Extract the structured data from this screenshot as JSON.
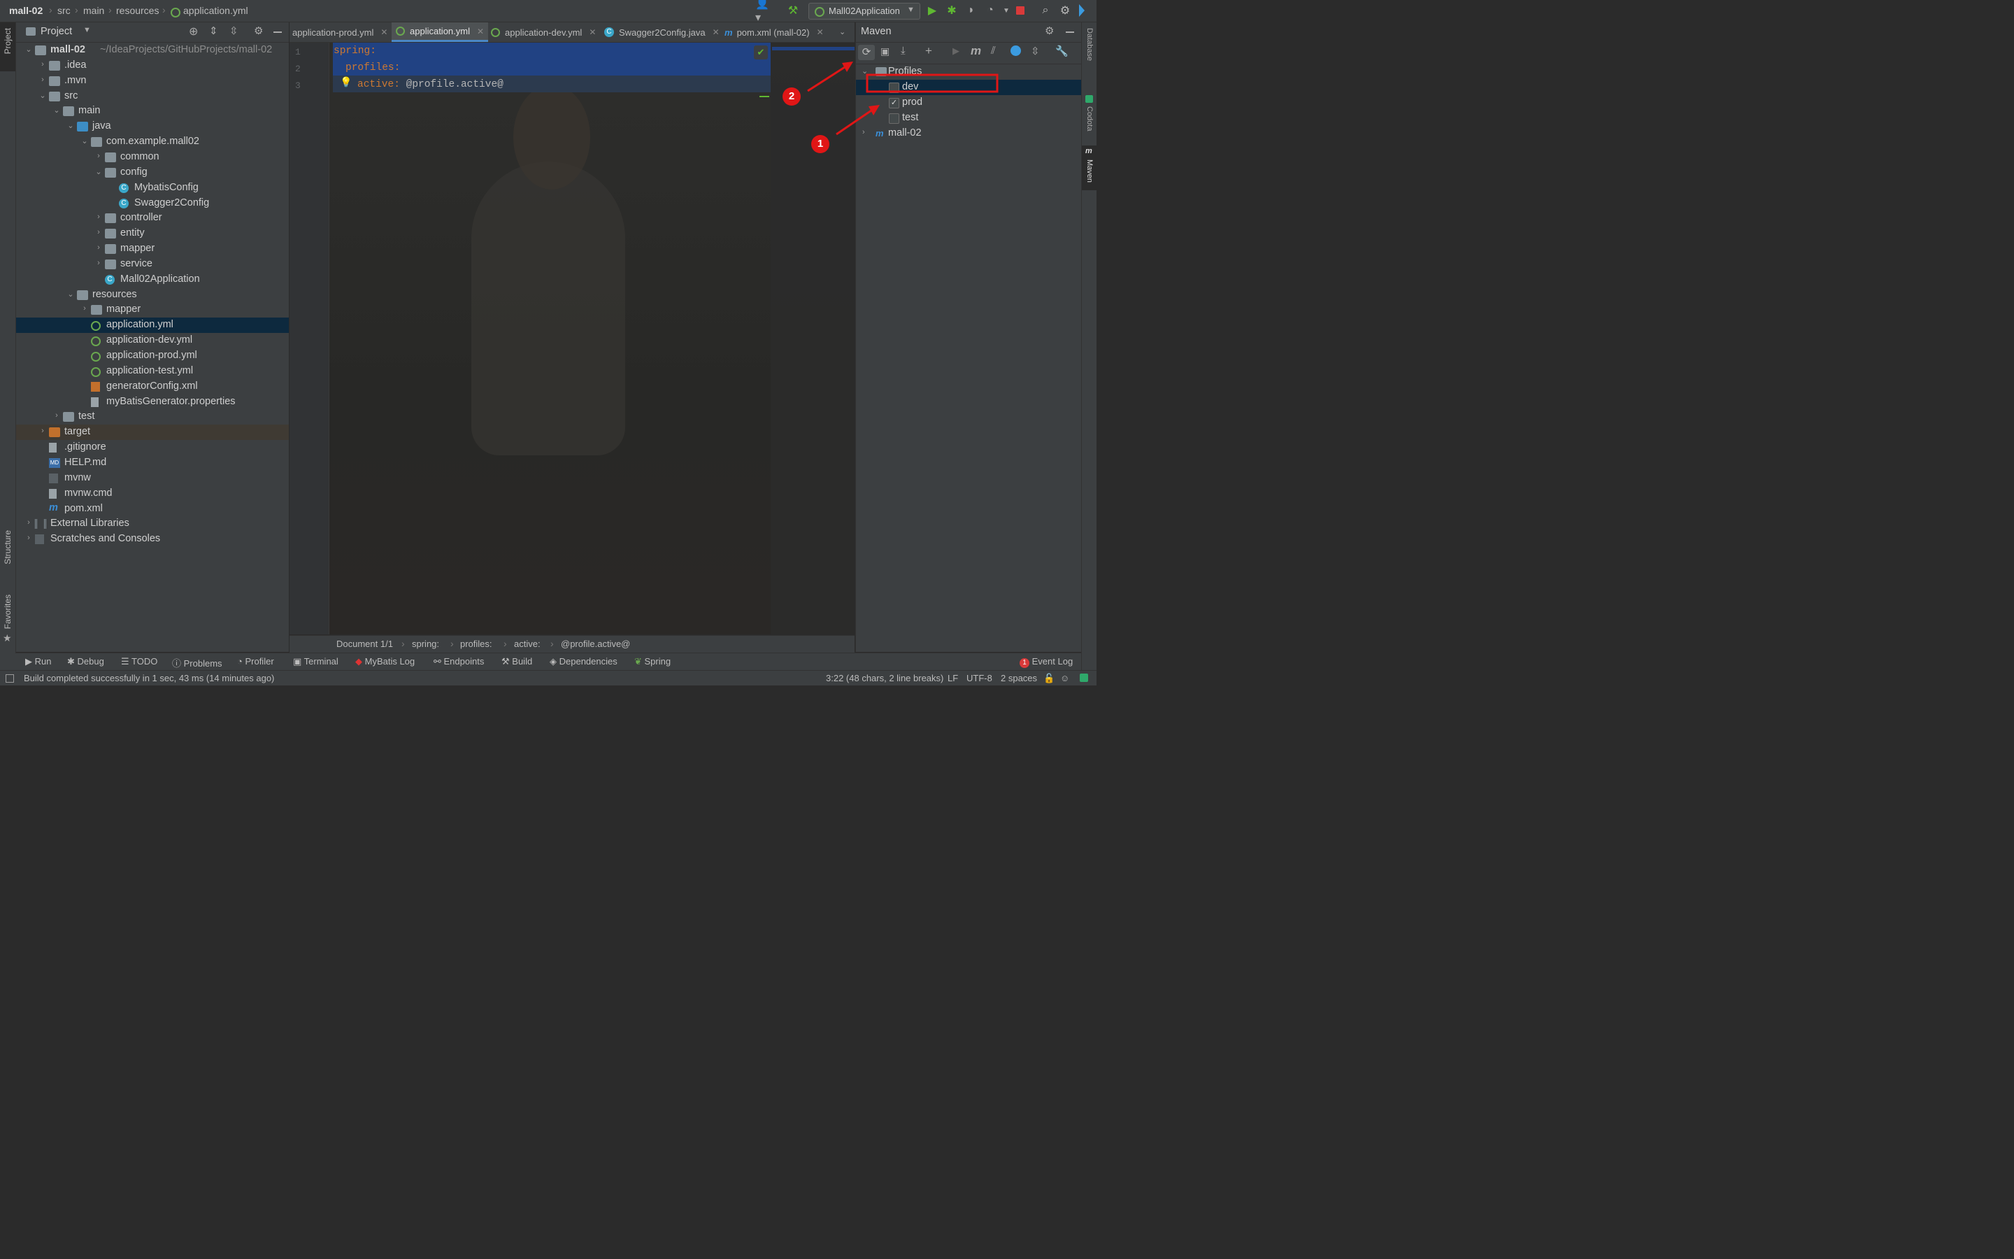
{
  "navbar": {
    "breadcrumbs": [
      "mall-02",
      "src",
      "main",
      "resources",
      "application.yml"
    ],
    "run_config": "Mall02Application"
  },
  "left_stripe": {
    "project": "Project",
    "structure": "Structure",
    "favorites": "Favorites"
  },
  "project_panel": {
    "title": "Project",
    "tree": [
      {
        "label": "mall-02",
        "hint": "~/IdeaProjects/GitHubProjects/mall-02",
        "depth": 0,
        "arrow": "open",
        "icon": "module-folder-icon"
      },
      {
        "label": ".idea",
        "depth": 1,
        "arrow": "closed",
        "icon": "folder-icon"
      },
      {
        "label": ".mvn",
        "depth": 1,
        "arrow": "closed",
        "icon": "folder-icon"
      },
      {
        "label": "src",
        "depth": 1,
        "arrow": "open",
        "icon": "folder-icon"
      },
      {
        "label": "main",
        "depth": 2,
        "arrow": "open",
        "icon": "folder-icon"
      },
      {
        "label": "java",
        "depth": 3,
        "arrow": "open",
        "icon": "source-folder-icon"
      },
      {
        "label": "com.example.mall02",
        "depth": 4,
        "arrow": "open",
        "icon": "package-icon"
      },
      {
        "label": "common",
        "depth": 5,
        "arrow": "closed",
        "icon": "package-icon"
      },
      {
        "label": "config",
        "depth": 5,
        "arrow": "open",
        "icon": "package-icon"
      },
      {
        "label": "MybatisConfig",
        "depth": 6,
        "arrow": "",
        "icon": "class-icon"
      },
      {
        "label": "Swagger2Config",
        "depth": 6,
        "arrow": "",
        "icon": "class-icon"
      },
      {
        "label": "controller",
        "depth": 5,
        "arrow": "closed",
        "icon": "package-icon"
      },
      {
        "label": "entity",
        "depth": 5,
        "arrow": "closed",
        "icon": "package-icon"
      },
      {
        "label": "mapper",
        "depth": 5,
        "arrow": "closed",
        "icon": "package-icon"
      },
      {
        "label": "service",
        "depth": 5,
        "arrow": "closed",
        "icon": "package-icon"
      },
      {
        "label": "Mall02Application",
        "depth": 5,
        "arrow": "",
        "icon": "spring-class-icon"
      },
      {
        "label": "resources",
        "depth": 3,
        "arrow": "open",
        "icon": "resources-folder-icon"
      },
      {
        "label": "mapper",
        "depth": 4,
        "arrow": "closed",
        "icon": "folder-icon"
      },
      {
        "label": "application.yml",
        "depth": 4,
        "arrow": "",
        "icon": "yml-icon",
        "selected": true
      },
      {
        "label": "application-dev.yml",
        "depth": 4,
        "arrow": "",
        "icon": "yml-icon"
      },
      {
        "label": "application-prod.yml",
        "depth": 4,
        "arrow": "",
        "icon": "yml-icon"
      },
      {
        "label": "application-test.yml",
        "depth": 4,
        "arrow": "",
        "icon": "yml-icon"
      },
      {
        "label": "generatorConfig.xml",
        "depth": 4,
        "arrow": "",
        "icon": "xml-icon"
      },
      {
        "label": "myBatisGenerator.properties",
        "depth": 4,
        "arrow": "",
        "icon": "properties-icon"
      },
      {
        "label": "test",
        "depth": 2,
        "arrow": "closed",
        "icon": "folder-icon"
      },
      {
        "label": "target",
        "depth": 1,
        "arrow": "closed",
        "icon": "excluded-folder-icon",
        "excluded": true
      },
      {
        "label": ".gitignore",
        "depth": 1,
        "arrow": "",
        "icon": "file-icon"
      },
      {
        "label": "HELP.md",
        "depth": 1,
        "arrow": "",
        "icon": "markdown-icon"
      },
      {
        "label": "mvnw",
        "depth": 1,
        "arrow": "",
        "icon": "script-icon"
      },
      {
        "label": "mvnw.cmd",
        "depth": 1,
        "arrow": "",
        "icon": "file-icon"
      },
      {
        "label": "pom.xml",
        "depth": 1,
        "arrow": "",
        "icon": "maven-icon"
      },
      {
        "label": "External Libraries",
        "depth": 0,
        "arrow": "closed",
        "icon": "libraries-icon"
      },
      {
        "label": "Scratches and Consoles",
        "depth": 0,
        "arrow": "closed",
        "icon": "scratches-icon"
      }
    ]
  },
  "tabs": [
    {
      "label": "application-prod.yml",
      "icon": "yml-icon"
    },
    {
      "label": "application.yml",
      "icon": "yml-icon",
      "active": true
    },
    {
      "label": "application-dev.yml",
      "icon": "yml-icon"
    },
    {
      "label": "Swagger2Config.java",
      "icon": "class-icon"
    },
    {
      "label": "pom.xml (mall-02)",
      "icon": "maven-icon"
    }
  ],
  "editor": {
    "lines": [
      {
        "num": "1",
        "key": "spring",
        "value": ""
      },
      {
        "num": "2",
        "key": "profiles",
        "value": ""
      },
      {
        "num": "3",
        "key": "active",
        "value": "@profile.active@"
      }
    ],
    "breadcrumb": [
      "Document 1/1",
      "spring:",
      "profiles:",
      "active:",
      "@profile.active@"
    ]
  },
  "maven": {
    "title": "Maven",
    "profiles_label": "Profiles",
    "profiles": [
      {
        "label": "dev",
        "checked": false
      },
      {
        "label": "prod",
        "checked": true
      },
      {
        "label": "test",
        "checked": false
      }
    ],
    "project": "mall-02"
  },
  "right_stripe": {
    "database": "Database",
    "codota": "Codota",
    "maven": "Maven"
  },
  "annotations": {
    "badge1": "1",
    "badge2": "2"
  },
  "tool_windows": [
    "Run",
    "Debug",
    "TODO",
    "Problems",
    "Profiler",
    "Terminal",
    "MyBatis Log",
    "Endpoints",
    "Build",
    "Dependencies",
    "Spring"
  ],
  "event_log": {
    "count": "1",
    "label": "Event Log"
  },
  "status": {
    "message": "Build completed successfully in 1 sec, 43 ms (14 minutes ago)",
    "position": "3:22 (48 chars, 2 line breaks)",
    "line_sep": "LF",
    "encoding": "UTF-8",
    "indent": "2 spaces"
  },
  "colors": {
    "accent": "#4a88c7",
    "selection": "#0d293e",
    "key": "#cc7832",
    "annotation": "#e01616"
  }
}
